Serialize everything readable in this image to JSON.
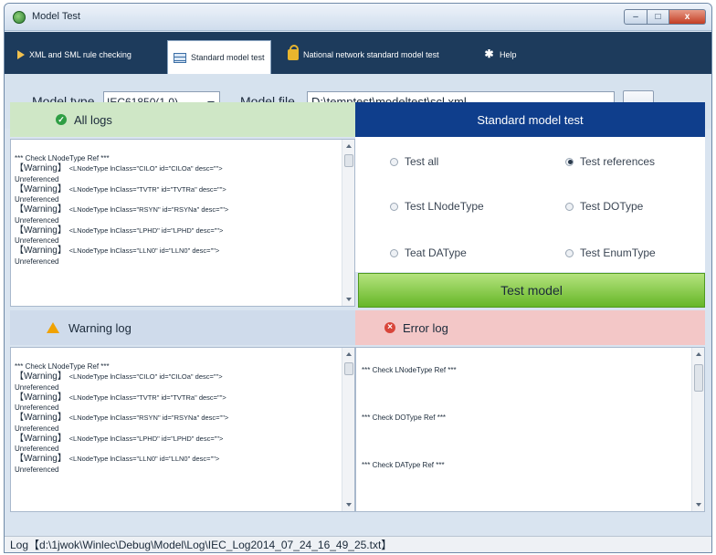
{
  "window": {
    "title": "Model Test",
    "min": "–",
    "max": "□",
    "close": "x"
  },
  "tabs": [
    {
      "label": "XML and SML rule checking",
      "icon": "arrow-icon"
    },
    {
      "label": "Standard model test",
      "icon": "table-icon",
      "active": true
    },
    {
      "label": "National network standard model test",
      "icon": "lock-icon"
    },
    {
      "label": "Help",
      "icon": "help-icon"
    }
  ],
  "toolbar": {
    "model_type_label": "Model type",
    "model_type_value": "IEC61850(1.0)",
    "model_file_label": "Model file",
    "model_file_value": "D:\\temptest\\modeltest\\scl.xml",
    "browse_label": "..."
  },
  "all_logs": {
    "title": "All logs",
    "header_line": "*** Check LNodeType Ref ***",
    "entries": [
      {
        "tag": "【Warning】",
        "text": "<LNodeType lnClass=\"CILO\" id=\"CILOa\" desc=\"\">",
        "status": "Unreferenced"
      },
      {
        "tag": "【Warning】",
        "text": "<LNodeType lnClass=\"TVTR\" id=\"TVTRa\" desc=\"\">",
        "status": "Unreferenced"
      },
      {
        "tag": "【Warning】",
        "text": "<LNodeType lnClass=\"RSYN\" id=\"RSYNa\" desc=\"\">",
        "status": "Unreferenced"
      },
      {
        "tag": "【Warning】",
        "text": "<LNodeType lnClass=\"LPHD\" id=\"LPHD\" desc=\"\">",
        "status": "Unreferenced"
      },
      {
        "tag": "【Warning】",
        "text": "<LNodeType lnClass=\"LLN0\" id=\"LLN0\" desc=\"\">",
        "status": "Unreferenced"
      }
    ]
  },
  "standard_test": {
    "title": "Standard model test",
    "options": [
      {
        "label": "Test all",
        "selected": false
      },
      {
        "label": "Test references",
        "selected": true
      },
      {
        "label": "Test LNodeType",
        "selected": false
      },
      {
        "label": "Test DOType",
        "selected": false
      },
      {
        "label": "Teat DAType",
        "selected": false
      },
      {
        "label": "Test EnumType",
        "selected": false
      }
    ],
    "button_label": "Test model"
  },
  "warning_log": {
    "title": "Warning log",
    "header_line": "*** Check LNodeType Ref ***",
    "entries": [
      {
        "tag": "【Warning】",
        "text": "<LNodeType lnClass=\"CILO\" id=\"CILOa\" desc=\"\">",
        "status": "Unreferenced"
      },
      {
        "tag": "【Warning】",
        "text": "<LNodeType lnClass=\"TVTR\" id=\"TVTRa\" desc=\"\">",
        "status": "Unreferenced"
      },
      {
        "tag": "【Warning】",
        "text": "<LNodeType lnClass=\"RSYN\" id=\"RSYNa\" desc=\"\">",
        "status": "Unreferenced"
      },
      {
        "tag": "【Warning】",
        "text": "<LNodeType lnClass=\"LPHD\" id=\"LPHD\" desc=\"\">",
        "status": "Unreferenced"
      },
      {
        "tag": "【Warning】",
        "text": "<LNodeType lnClass=\"LLN0\" id=\"LLN0\" desc=\"\">",
        "status": "Unreferenced"
      }
    ]
  },
  "error_log": {
    "title": "Error log",
    "lines": [
      "*** Check LNodeType Ref ***",
      "*** Check DOType Ref ***",
      "*** Check DAType Ref ***"
    ]
  },
  "status": {
    "text": "Log【d:\\1jwok\\Winlec\\Debug\\Model\\Log\\IEC_Log2014_07_24_16_49_25.txt】"
  },
  "colors": {
    "tabbar": "#1d3b5c",
    "std_header": "#0f3e8c",
    "all_logs_header": "#cfe7c6",
    "warning_header": "#cfdbeb",
    "error_header": "#f3c7c7",
    "test_button": "#66b627"
  }
}
